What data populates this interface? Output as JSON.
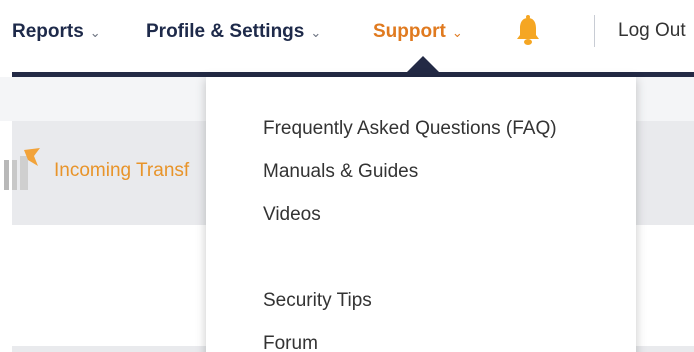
{
  "nav": {
    "reports": "Reports",
    "profile": "Profile & Settings",
    "support": "Support",
    "chevron": "⌄",
    "logout": "Log Out"
  },
  "background": {
    "incoming_label": "Incoming Transf"
  },
  "support_menu": {
    "items": [
      "Frequently Asked Questions (FAQ)",
      "Manuals & Guides",
      "Videos",
      "Security Tips",
      "Forum"
    ]
  },
  "colors": {
    "accent": "#e07a1f",
    "navy": "#232a45",
    "bell": "#f5a623"
  },
  "icons": {
    "bell": "bell-icon",
    "chevron": "chevron-down-icon",
    "incoming": "incoming-transfer-icon"
  }
}
